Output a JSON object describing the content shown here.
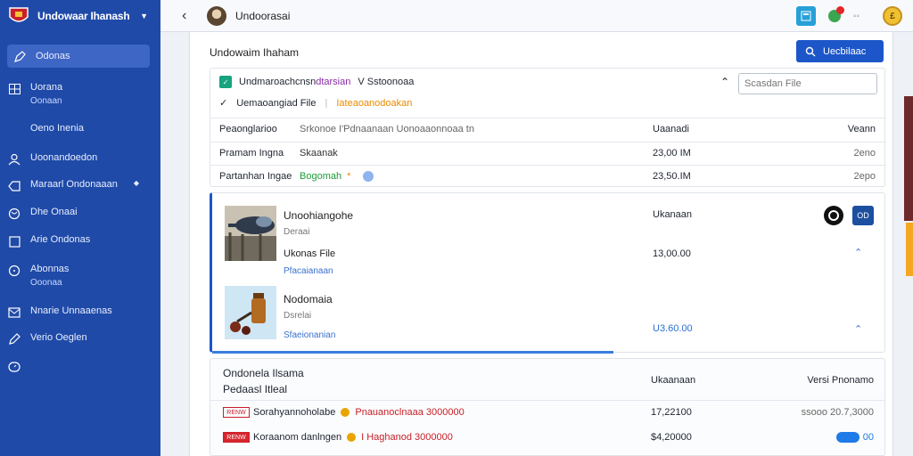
{
  "sidebar": {
    "title": "Undowaar Ihanash",
    "items": [
      {
        "label": "Odonas",
        "icon": "pen-icon",
        "active": true
      },
      {
        "label": "Uorana",
        "sub": "Oonaan",
        "icon": "grid-icon"
      },
      {
        "label": "Oeno Inenia",
        "icon": "none"
      },
      {
        "label": "Uoonandoedon",
        "icon": "user-icon"
      },
      {
        "label": "Maraarl Ondonaaan",
        "icon": "tag-icon"
      },
      {
        "label": "Dhe Onaai",
        "icon": "globe-icon"
      },
      {
        "label": "Arie Ondonas",
        "icon": "square-icon"
      },
      {
        "label": "Abonnas",
        "sub": "Ooonaa",
        "icon": "circle-icon"
      },
      {
        "label": "Nnarie Unnaaenas",
        "icon": "mail-icon"
      },
      {
        "label": "Verio Oeglen",
        "icon": "pencil-icon"
      },
      {
        "label": "",
        "icon": "gauge-icon"
      }
    ]
  },
  "topbar": {
    "title": "Undoorasai",
    "coin_label": "£"
  },
  "page": {
    "title": "Undowaim Ihaham",
    "primary_button": "Uecbilaac"
  },
  "panel1": {
    "heading_a": "Undmaroachcnsn",
    "heading_b": "dtarsian",
    "heading_c": "V  Sstoonoaa",
    "search_placeholder": "Scasdan File",
    "filter_label": "Uemaoangiad File",
    "filter_tag": "Iateaoanodoakan",
    "header": [
      "Peaonglarioo",
      "Srkonoe  I'Pdnaanaan Uonoaaonnoaa  tn",
      "Uaanadi",
      "Veann"
    ],
    "rows": [
      {
        "a": "Pramam Ingna",
        "b": "Skaanak",
        "c": "23,00  IM",
        "d": "2eno"
      },
      {
        "a": "Partanhan Ingae",
        "b": "Bogomah",
        "b_extra": "*",
        "c": "23,50.IM",
        "d": "2epo"
      }
    ]
  },
  "panel2": {
    "items": [
      {
        "name": "Unoohiangohe",
        "sub": "Deraai",
        "file": "Ukonas File",
        "link": "Pfacaianaan",
        "value_label": "Ukanaan",
        "value": "13,00.00"
      },
      {
        "name": "Nodomaia",
        "sub": "Dsrelai",
        "link": "Sfaeionanian",
        "value": "U3.60.00"
      }
    ],
    "square_button": "OD"
  },
  "panel3": {
    "title": "Ondonela Ilsama",
    "subtitle": "Pedaasl Itleal",
    "head_c": "Ukaanaan",
    "head_d": "Versi  Pnonamo",
    "rows": [
      {
        "flag": "RENW",
        "name": "Sorahyannoholabe",
        "amount": "Pnauanoclnaaa 3000000",
        "value": "17,22100",
        "extra": "ssooo 20.7,3000"
      },
      {
        "flag": "RENW",
        "name": "Koraanom danlngen",
        "amount": "I Haghanod 3000000",
        "value": "$4,20000",
        "extra": "00"
      }
    ]
  },
  "colors": {
    "sidebar": "#1f4aa8",
    "accent": "#1c56c9",
    "success": "#17a37e",
    "warning": "#e98a00",
    "danger": "#c8202a"
  }
}
